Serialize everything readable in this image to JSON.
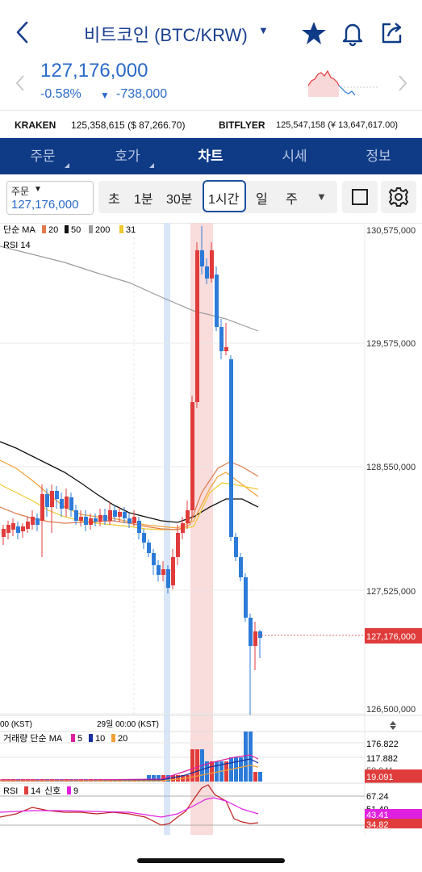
{
  "header": {
    "title": "비트코인 (BTC/KRW)",
    "icons": [
      "back-arrow-icon",
      "caret-down-icon",
      "star-icon",
      "bell-icon",
      "share-icon"
    ]
  },
  "ticker": {
    "price": "127,176,000",
    "change_rate": "-0.58%",
    "change_amount": "-738,000",
    "color": "#2a6ac8"
  },
  "exchanges": [
    {
      "name": "KRAKEN",
      "value": "125,358,615 ($ 87,266.70)"
    },
    {
      "name": "BITFLYER",
      "value": "125,547,158 (¥ 13,647,617.00)"
    }
  ],
  "nav": {
    "tabs": [
      {
        "label": "주문",
        "active": false
      },
      {
        "label": "호가",
        "active": false
      },
      {
        "label": "차트",
        "active": true
      },
      {
        "label": "시세",
        "active": false
      },
      {
        "label": "정보",
        "active": false
      }
    ],
    "bg_color": "#0f3b86"
  },
  "toolbar": {
    "order_label": "주문",
    "order_price": "127,176,000",
    "timeframes": [
      "초",
      "1분",
      "30분",
      "1시간",
      "일",
      "주"
    ],
    "selected_timeframe": "1시간"
  },
  "chart": {
    "legend_ma": {
      "label": "단순 MA",
      "periods": [
        "20",
        "50",
        "200",
        "31"
      ]
    },
    "legend_rsi": "RSI 14",
    "price_axis": [
      "130,575,000",
      "129,575,000",
      "128,550,000",
      "127,525,000",
      "126,500,000"
    ],
    "current_price_tag": "127,176,000",
    "up_color": "#e03c3c",
    "down_color": "#2d7bd8",
    "time_labels": [
      "00 (KST)",
      "29일 00:00 (KST)"
    ],
    "volume_legend": {
      "label": "거래량 단순 MA",
      "periods": [
        "5",
        "10",
        "20"
      ]
    },
    "volume_axis": [
      "176.822",
      "117.882",
      "19.091"
    ],
    "volume_overlap_label": "58.941",
    "rsi_legend": {
      "label": "RSI",
      "period": "14",
      "signal_label": "신호",
      "signal_period": "9"
    },
    "rsi_axis": [
      "67.24",
      "51.40",
      "43.41",
      "34.82"
    ]
  }
}
